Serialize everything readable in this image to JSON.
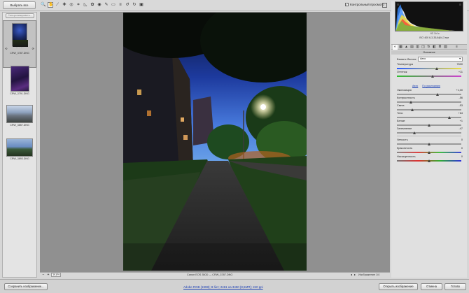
{
  "toolbar": {
    "select_all_label": "Выбрать все",
    "sync_label": "Синхронизировать...",
    "tools": [
      {
        "icon": "zoom-icon",
        "glyph": "🔍"
      },
      {
        "icon": "hand-icon",
        "glyph": "✋"
      },
      {
        "icon": "white-balance-icon",
        "glyph": "⟋"
      },
      {
        "icon": "color-sampler-icon",
        "glyph": "✚"
      },
      {
        "icon": "targeted-adjustment-icon",
        "glyph": "◎"
      },
      {
        "icon": "crop-icon",
        "glyph": "⌗"
      },
      {
        "icon": "straighten-icon",
        "glyph": "◺"
      },
      {
        "icon": "spot-removal-icon",
        "glyph": "✿"
      },
      {
        "icon": "red-eye-icon",
        "glyph": "◉"
      },
      {
        "icon": "adjustment-brush-icon",
        "glyph": "✎"
      },
      {
        "icon": "graduated-filter-icon",
        "glyph": "▭"
      },
      {
        "icon": "preferences-icon",
        "glyph": "≡"
      },
      {
        "icon": "rotate-ccw-icon",
        "glyph": "↺"
      },
      {
        "icon": "rotate-cw-icon",
        "glyph": "↻"
      },
      {
        "icon": "trash-icon",
        "glyph": "▣"
      }
    ],
    "preview_label": "Контрольный просмотр",
    "preview_checked": true
  },
  "filmstrip": {
    "items": [
      {
        "label": "CRW_3787.DNG",
        "selected": true,
        "rating_dots": "· · · · ·"
      },
      {
        "label": "CRW_3791.DNG",
        "selected": false
      },
      {
        "label": "CRW_3857.DNG",
        "selected": false
      },
      {
        "label": "CRW_3893.DNG",
        "selected": false
      }
    ]
  },
  "canvas": {
    "zoom": "39,8%",
    "file_info": "Canon EOS 350D   —   CRW_3787.DNG",
    "image_counter": "Изображение 1/4"
  },
  "panel": {
    "readouts": {
      "aperture_shutter": "f/2   1/4 с",
      "iso_lens": "ISO 400   6,3-35,8@4,3 мм"
    },
    "section_title": "Основное",
    "white_balance_label": "Баланс белого:",
    "white_balance_value": "Авто",
    "auto_label": "Авто",
    "default_label": "По умолчанию",
    "sliders": [
      {
        "name": "temperature",
        "label": "Температура",
        "value": "7600",
        "pos": 0.62
      },
      {
        "name": "tint",
        "label": "Оттенок",
        "value": "+11",
        "pos": 0.55
      },
      {
        "name": "exposure",
        "label": "Экспозиция",
        "value": "+1,00",
        "pos": 0.63
      },
      {
        "name": "contrast",
        "label": "Контрастность",
        "value": "-56",
        "pos": 0.22
      },
      {
        "name": "highlights",
        "label": "Света",
        "value": "-53",
        "pos": 0.24
      },
      {
        "name": "shadows",
        "label": "Тени",
        "value": "+64",
        "pos": 0.82
      },
      {
        "name": "whites",
        "label": "Белые",
        "value": "+1",
        "pos": 0.5
      },
      {
        "name": "blacks",
        "label": "Затемнение",
        "value": "-47",
        "pos": 0.27
      },
      {
        "name": "clarity",
        "label": "Четкость",
        "value": "0",
        "pos": 0.5
      },
      {
        "name": "vibrance",
        "label": "Красочность",
        "value": "0",
        "pos": 0.5
      },
      {
        "name": "saturation",
        "label": "Насыщенность",
        "value": "0",
        "pos": 0.5
      }
    ]
  },
  "bottombar": {
    "save_label": "Сохранить изображение...",
    "workflow_link": "Adobe RGB (1998); 8 бит; 2461 на 3450 (8,5МП); 240 ppi",
    "open_label": "Открыть изображение",
    "cancel_label": "Отмена",
    "done_label": "Готово"
  }
}
